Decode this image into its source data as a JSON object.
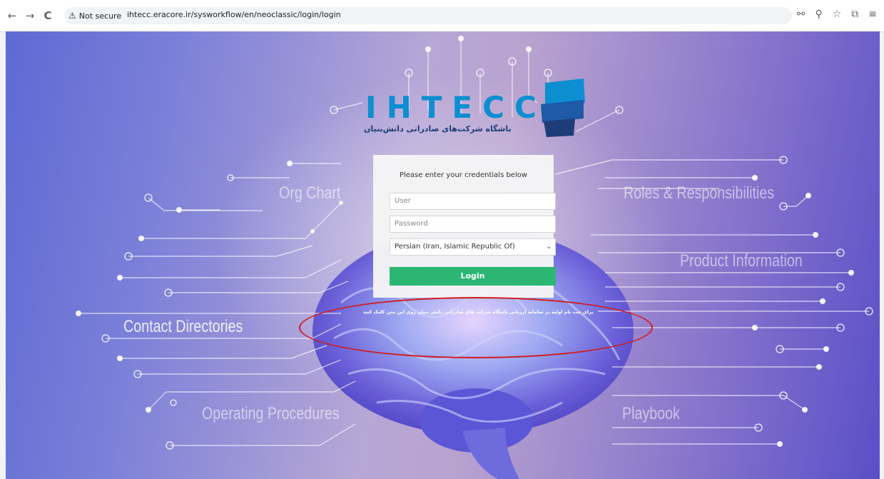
{
  "browser": {
    "back_icon": "←",
    "forward_icon": "→",
    "reload_icon": "C",
    "security_icon": "⚠",
    "security_label": "Not secure",
    "url": "ihtecc.eracore.ir/sysworkflow/en/neoclassic/login/login",
    "tools": {
      "password_icon": "⚯",
      "zoom_icon": "⚲",
      "bookmark_icon": "☆",
      "extensions_icon": "⧉",
      "menu_icon": "≡"
    }
  },
  "background_labels": {
    "org_chart": "Org Chart",
    "roles": "Roles & Responsibilities",
    "product_info": "Product Information",
    "contact_dirs": "Contact Directories",
    "operating_procs": "Operating Procedures",
    "playbook": "Playbook"
  },
  "logo": {
    "text": "IHTECC",
    "subtitle": "باشگاه شرکت‌های صادراتی دانش‌بنیان",
    "colors": {
      "primary": "#0d8ed1",
      "dark": "#1e3d78"
    }
  },
  "login": {
    "heading": "Please enter your credentials below",
    "user_placeholder": "User",
    "password_placeholder": "Password",
    "language_selected": "Persian (Iran, Islamic Republic Of)",
    "login_label": "Login",
    "button_color": "#2bb673"
  },
  "register_text": "برای ثبت نام اولیه در سامانه ارزیابی باشگاه شرکت های صادراتی دانش بنیان روی این متن کلیک کنید",
  "annotation_color": "#d11a1a"
}
